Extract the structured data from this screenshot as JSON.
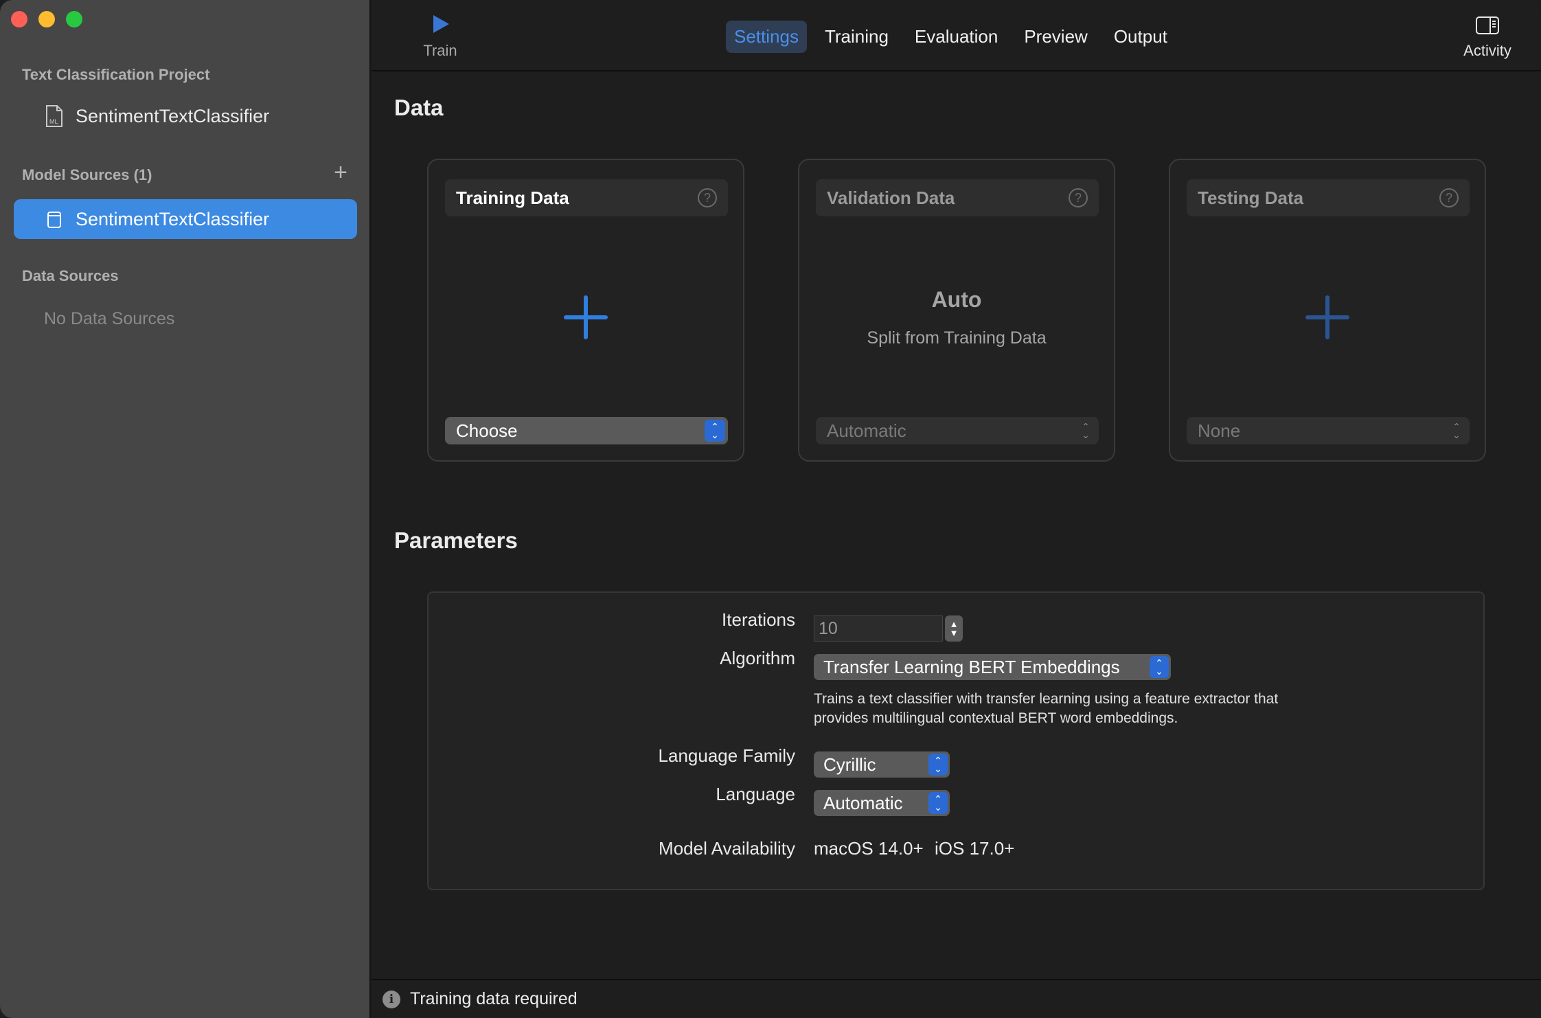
{
  "sidebar": {
    "project_section": "Text Classification Project",
    "project_item": "SentimentTextClassifier",
    "model_sources_section": "Model Sources (1)",
    "model_source_item": "SentimentTextClassifier",
    "data_sources_section": "Data Sources",
    "data_sources_empty": "No Data Sources",
    "add_symbol": "+",
    "file_badge": "ML"
  },
  "toolbar": {
    "train_label": "Train",
    "activity_label": "Activity",
    "tabs": [
      {
        "label": "Settings",
        "active": true
      },
      {
        "label": "Training",
        "active": false
      },
      {
        "label": "Evaluation",
        "active": false
      },
      {
        "label": "Preview",
        "active": false
      },
      {
        "label": "Output",
        "active": false
      }
    ]
  },
  "data_section": {
    "heading": "Data",
    "training": {
      "title": "Training Data",
      "select_value": "Choose"
    },
    "validation": {
      "title": "Validation Data",
      "big_text": "Auto",
      "sub_text": "Split from Training Data",
      "select_value": "Automatic"
    },
    "testing": {
      "title": "Testing Data",
      "select_value": "None"
    }
  },
  "parameters": {
    "heading": "Parameters",
    "iterations_label": "Iterations",
    "iterations_value": "10",
    "algorithm_label": "Algorithm",
    "algorithm_value": "Transfer Learning BERT Embeddings",
    "algorithm_desc_line1": "Trains a text classifier with transfer learning using a feature extractor that",
    "algorithm_desc_line2": "provides multilingual contextual BERT word embeddings.",
    "language_family_label": "Language Family",
    "language_family_value": "Cyrillic",
    "language_label": "Language",
    "language_value": "Automatic",
    "availability_label": "Model Availability",
    "availability_macos": "macOS 14.0+",
    "availability_ios": "iOS 17.0+"
  },
  "status": {
    "icon": "info-icon",
    "icon_glyph": "i",
    "text": "Training data required"
  },
  "colors": {
    "accent": "#3d8ae3",
    "sidebar_bg": "#464646",
    "main_bg": "#1e1e1e"
  }
}
